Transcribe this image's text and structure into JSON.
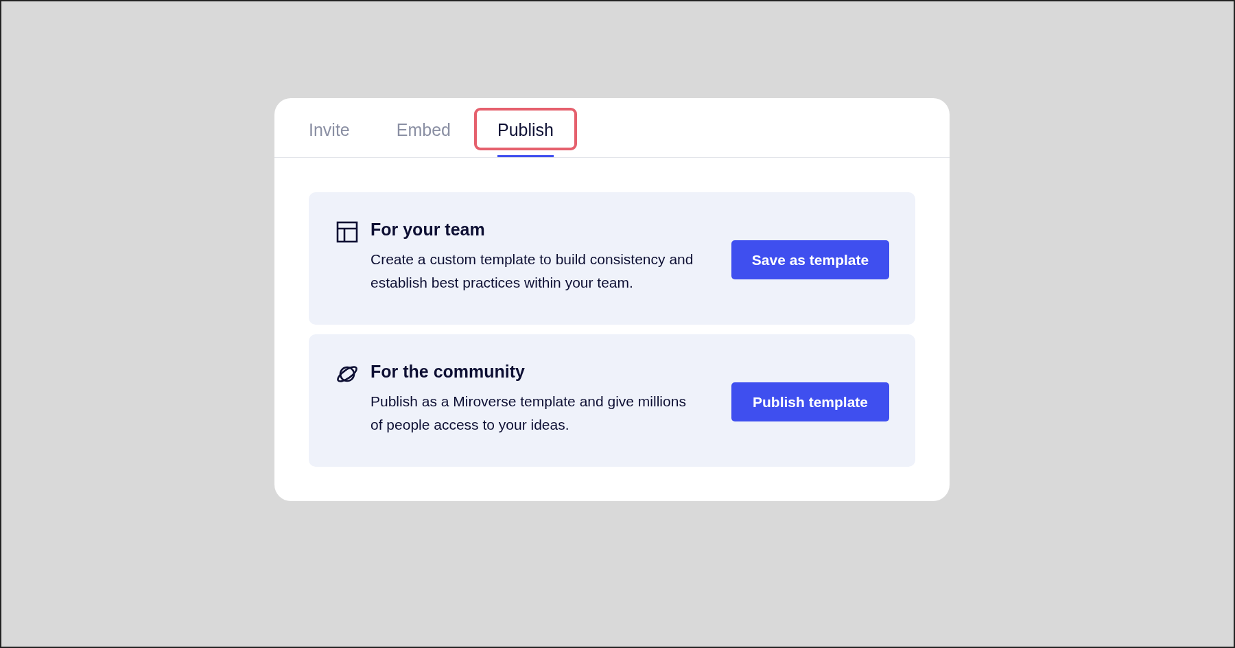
{
  "tabs": [
    {
      "label": "Invite",
      "selected": false,
      "highlighted": false
    },
    {
      "label": "Embed",
      "selected": false,
      "highlighted": false
    },
    {
      "label": "Publish",
      "selected": true,
      "highlighted": true
    }
  ],
  "options": [
    {
      "kind": "layout",
      "title": "For your team",
      "description": "Create a custom template to build consistency and establish best practices within your team.",
      "button": "Save as template"
    },
    {
      "kind": "planet",
      "title": "For the community",
      "description": "Publish as a Miroverse template and give millions of people access to your ideas.",
      "button": "Publish template"
    }
  ]
}
